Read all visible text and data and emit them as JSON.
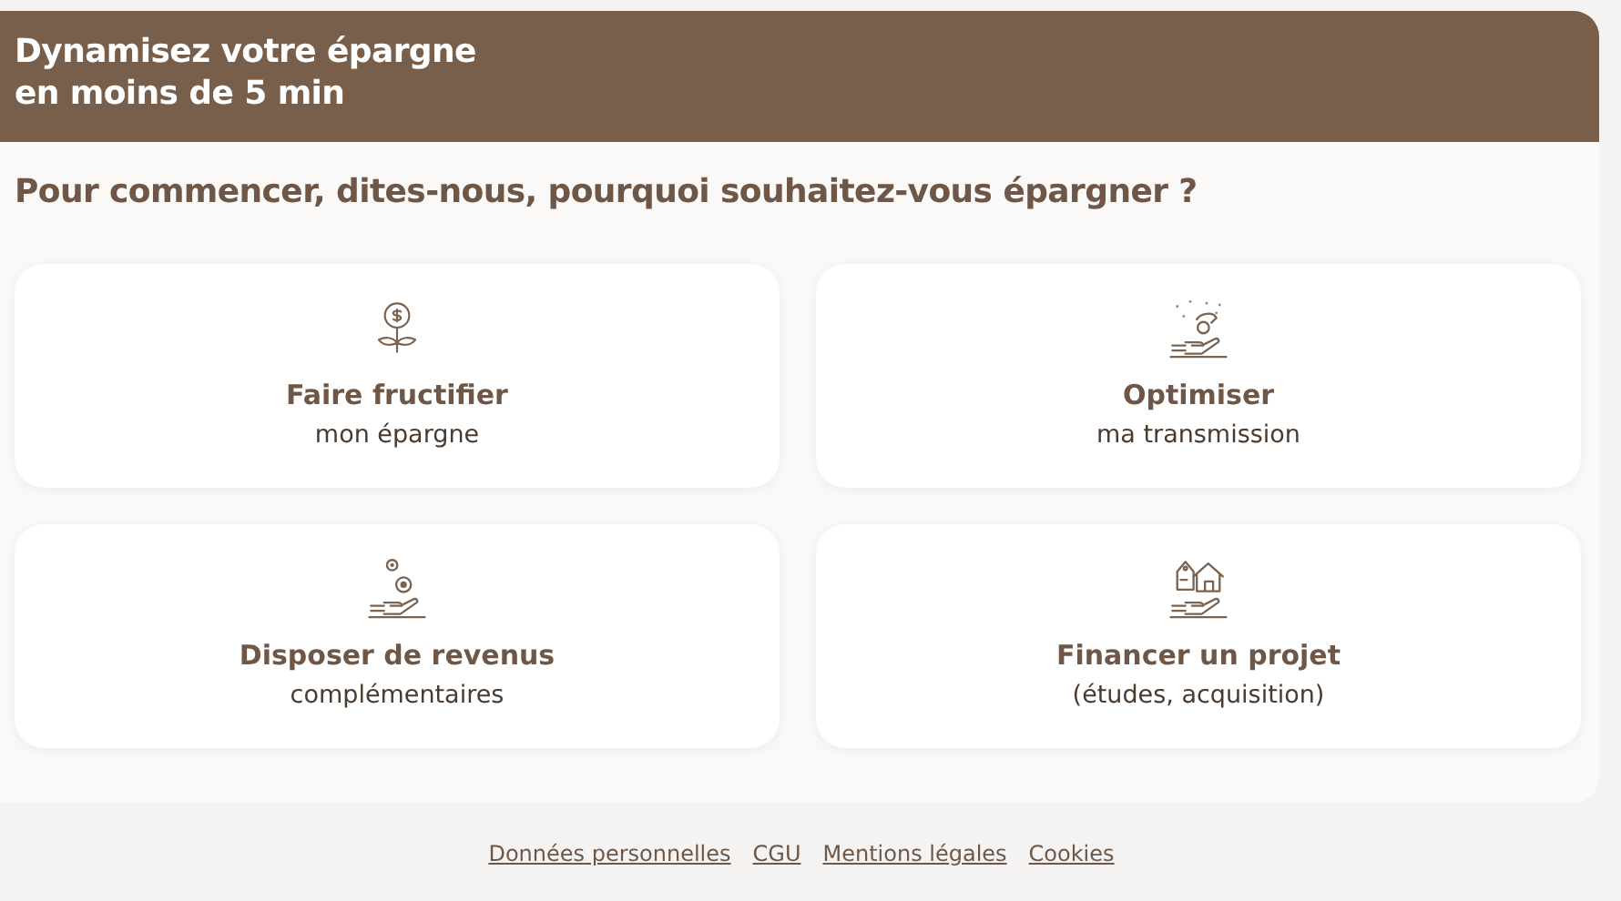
{
  "header": {
    "title_lines": [
      "Dynamisez votre épargne",
      "en moins de 5 min"
    ]
  },
  "question": "Pour commencer, dites-nous, pourquoi souhaitez-vous épargner ?",
  "options": [
    {
      "kind": "plant",
      "title": "Faire fructifier",
      "subtitle": "mon épargne"
    },
    {
      "kind": "transmission",
      "title": "Optimiser",
      "subtitle": "ma transmission"
    },
    {
      "kind": "coins",
      "title": "Disposer de revenus",
      "subtitle": "complémentaires"
    },
    {
      "kind": "house",
      "title": "Financer un projet",
      "subtitle": "(études, acquisition)"
    }
  ],
  "footer_links": [
    "Données personnelles",
    "CGU",
    "Mentions légales",
    "Cookies"
  ]
}
